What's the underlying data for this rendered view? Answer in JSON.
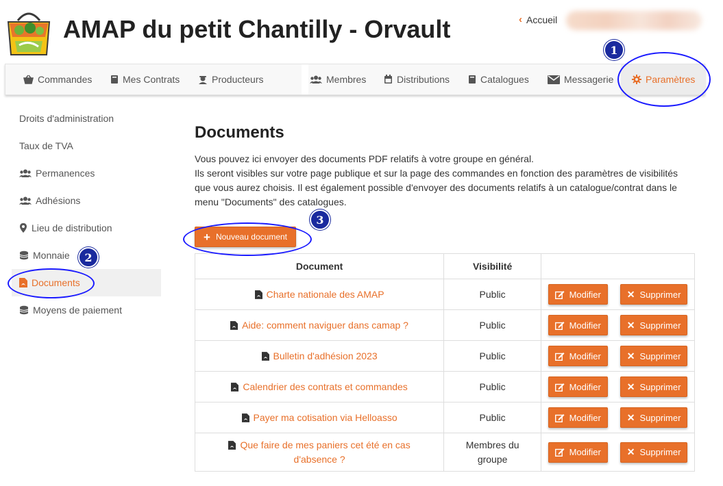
{
  "header": {
    "app_title": "AMAP du petit Chantilly - Orvault",
    "home_link": "Accueil"
  },
  "nav": {
    "left": [
      {
        "label": "Commandes",
        "icon": "basket-icon"
      },
      {
        "label": "Mes Contrats",
        "icon": "book-icon"
      },
      {
        "label": "Producteurs",
        "icon": "farmer-icon"
      }
    ],
    "right": [
      {
        "label": "Membres",
        "icon": "users-icon"
      },
      {
        "label": "Distributions",
        "icon": "calendar-icon"
      },
      {
        "label": "Catalogues",
        "icon": "book-icon"
      },
      {
        "label": "Messagerie",
        "icon": "envelope-icon"
      },
      {
        "label": "Paramètres",
        "icon": "gear-icon",
        "active": true
      }
    ]
  },
  "sidebar": {
    "items": [
      {
        "label": "Droits d'administration"
      },
      {
        "label": "Taux de TVA"
      },
      {
        "label": "Permanences",
        "icon": "users-icon"
      },
      {
        "label": "Adhésions",
        "icon": "users-icon"
      },
      {
        "label": "Lieu de distribution",
        "icon": "map-marker-icon"
      },
      {
        "label": "Monnaie",
        "icon": "coins-icon"
      },
      {
        "label": "Documents",
        "icon": "pdf-file-icon",
        "active": true
      },
      {
        "label": "Moyens de paiement",
        "icon": "coins-icon"
      }
    ]
  },
  "main": {
    "title": "Documents",
    "intro_line1": "Vous pouvez ici envoyer des documents PDF relatifs à votre groupe en général.",
    "intro_line2": "Ils seront visibles sur votre page publique et sur la page des commandes en fonction des paramètres de visibilités que vous aurez choisis. Il est également possible d'envoyer des documents relatifs à un catalogue/contrat dans le menu \"Documents\" des catalogues.",
    "new_button": "Nouveau document",
    "table": {
      "headers": [
        "Document",
        "Visibilité",
        ""
      ],
      "edit_label": "Modifier",
      "delete_label": "Supprimer",
      "rows": [
        {
          "name": "Charte nationale des AMAP",
          "visibility": "Public"
        },
        {
          "name": "Aide: comment naviguer dans camap ?",
          "visibility": "Public"
        },
        {
          "name": "Bulletin d'adhésion 2023",
          "visibility": "Public"
        },
        {
          "name": "Calendrier des contrats et commandes",
          "visibility": "Public"
        },
        {
          "name": "Payer ma cotisation via Helloasso",
          "visibility": "Public"
        },
        {
          "name": "Que faire de mes paniers cet été en cas d'absence ?",
          "visibility": "Membres du groupe"
        }
      ]
    }
  },
  "annotations": {
    "badges": [
      "1",
      "2",
      "3"
    ],
    "color": "#1a1aff"
  },
  "colors": {
    "accent": "#e8702a",
    "navbar_bg": "#f8f8f8",
    "annotation": "#1a2a9e"
  }
}
